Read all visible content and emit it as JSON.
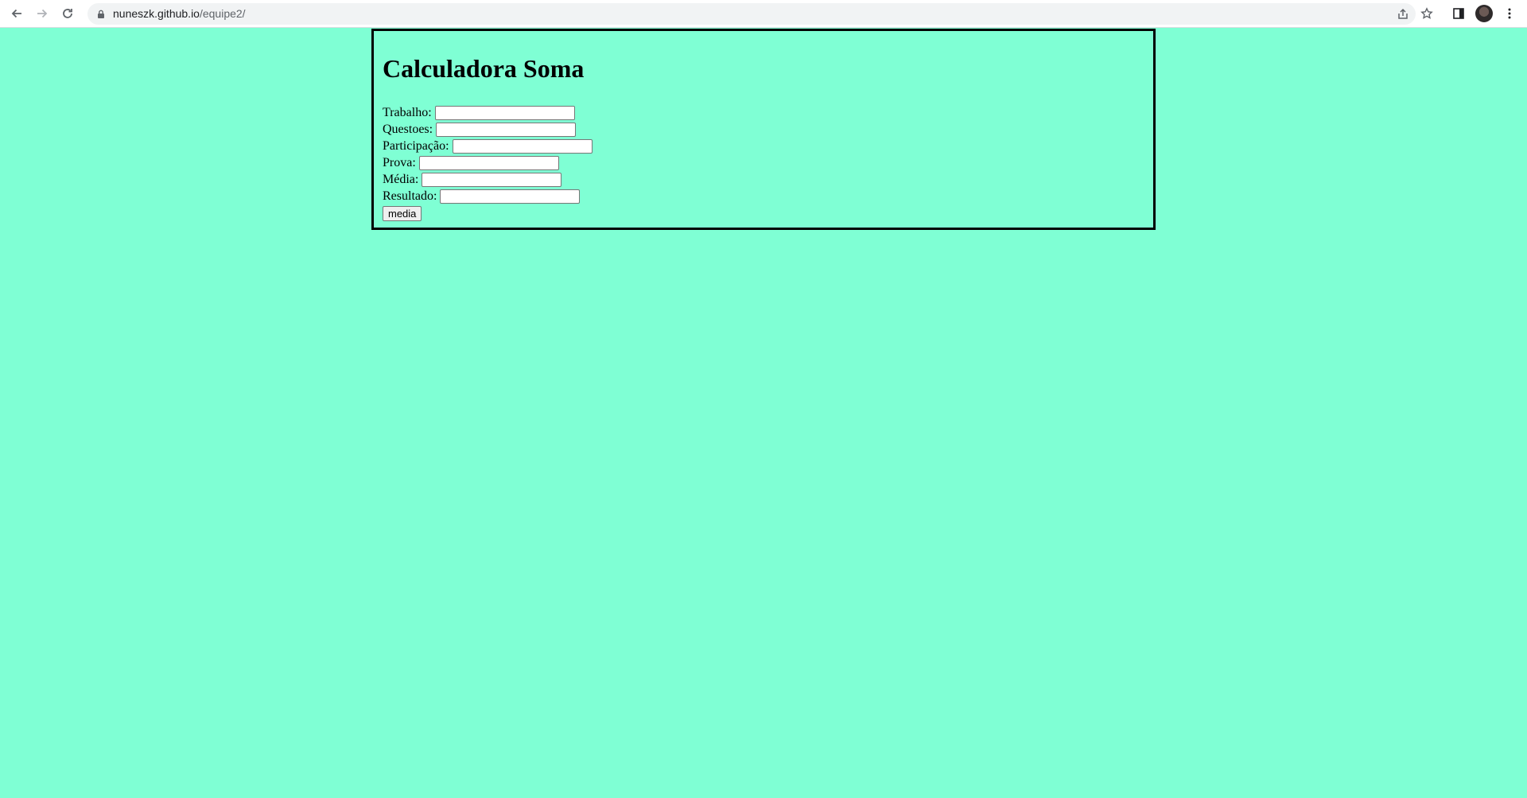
{
  "browser": {
    "url_host": "nuneszk.github.io",
    "url_path": "/equipe2/"
  },
  "page": {
    "title": "Calculadora Soma",
    "fields": [
      {
        "label": "Trabalho:",
        "value": ""
      },
      {
        "label": "Questoes:",
        "value": ""
      },
      {
        "label": "Participação:",
        "value": ""
      },
      {
        "label": "Prova:",
        "value": ""
      },
      {
        "label": "Média:",
        "value": ""
      },
      {
        "label": "Resultado:",
        "value": ""
      }
    ],
    "button_label": "media",
    "background_color": "#7fffd4"
  }
}
